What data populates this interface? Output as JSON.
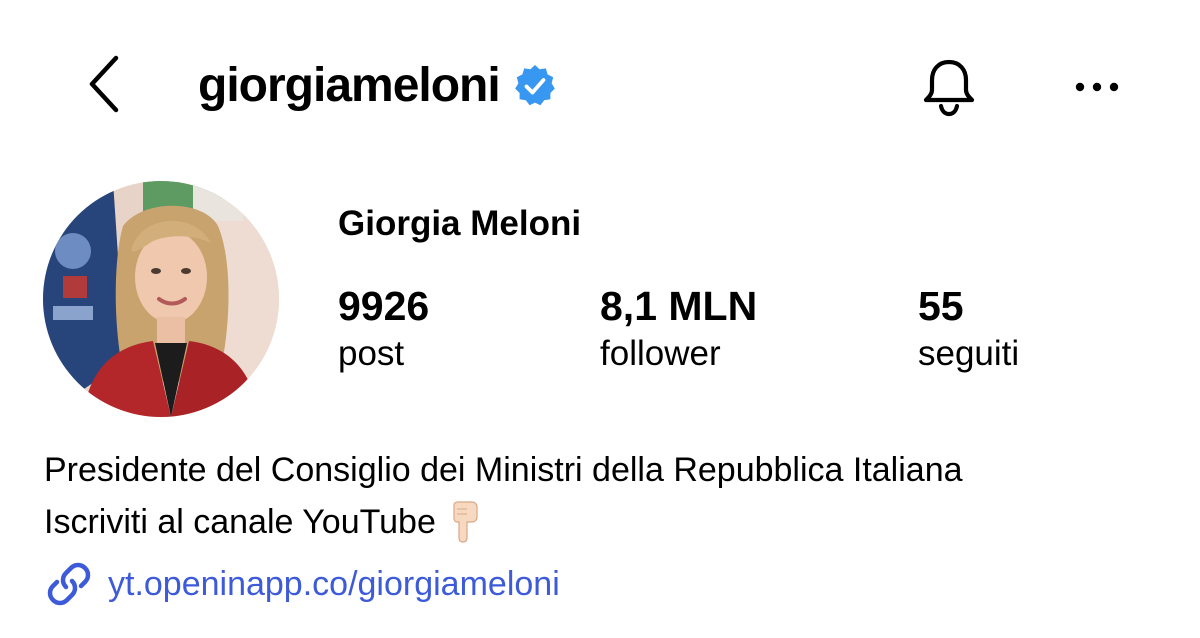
{
  "header": {
    "username": "giorgiameloni",
    "verified": true,
    "back_icon": "chevron-left-icon",
    "bell_icon": "bell-icon",
    "more_icon": "more-horizontal-icon"
  },
  "profile": {
    "full_name": "Giorgia Meloni",
    "stats": {
      "posts": {
        "value": "9926",
        "label": "post"
      },
      "followers": {
        "value": "8,1 MLN",
        "label": "follower"
      },
      "following": {
        "value": "55",
        "label": "seguiti"
      }
    }
  },
  "bio": {
    "line1": "Presidente del Consiglio dei Ministri della Repubblica Italiana",
    "line2": "Iscriviti al canale YouTube",
    "line2_emoji": "pointing-down-hand-icon",
    "link": "yt.openinapp.co/giorgiameloni"
  },
  "colors": {
    "verified_badge": "#3897f0",
    "link": "#3d5bd9",
    "text": "#000000",
    "background": "#ffffff"
  }
}
